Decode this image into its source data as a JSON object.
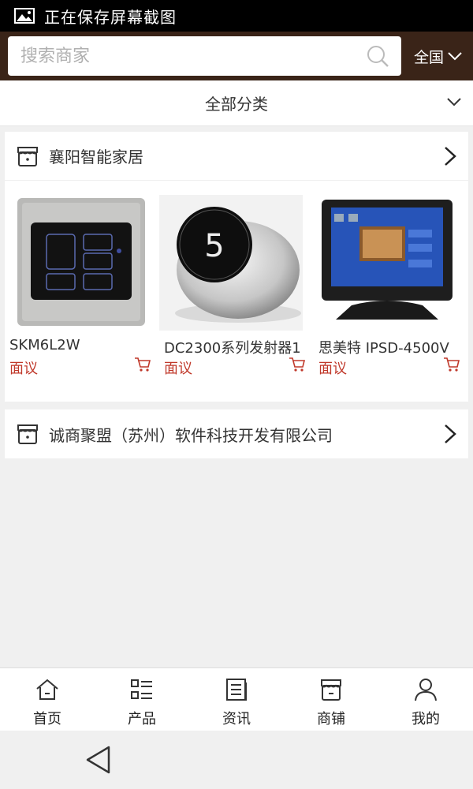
{
  "status_bar": {
    "text": "正在保存屏幕截图"
  },
  "search": {
    "placeholder": "搜索商家",
    "region": "全国"
  },
  "category": {
    "label": "全部分类"
  },
  "shops": [
    {
      "name": "襄阳智能家居",
      "products": [
        {
          "name": "SKM6L2W",
          "price": "面议"
        },
        {
          "name": "DC2300系列发射器1",
          "price": "面议"
        },
        {
          "name": "思美特 IPSD-4500V",
          "price": "面议"
        }
      ]
    },
    {
      "name": "诚商聚盟（苏州）软件科技开发有限公司"
    }
  ],
  "nav": [
    {
      "label": "首页",
      "icon": "home-icon"
    },
    {
      "label": "产品",
      "icon": "list-icon"
    },
    {
      "label": "资讯",
      "icon": "news-icon"
    },
    {
      "label": "商铺",
      "icon": "store-icon"
    },
    {
      "label": "我的",
      "icon": "user-icon"
    }
  ]
}
